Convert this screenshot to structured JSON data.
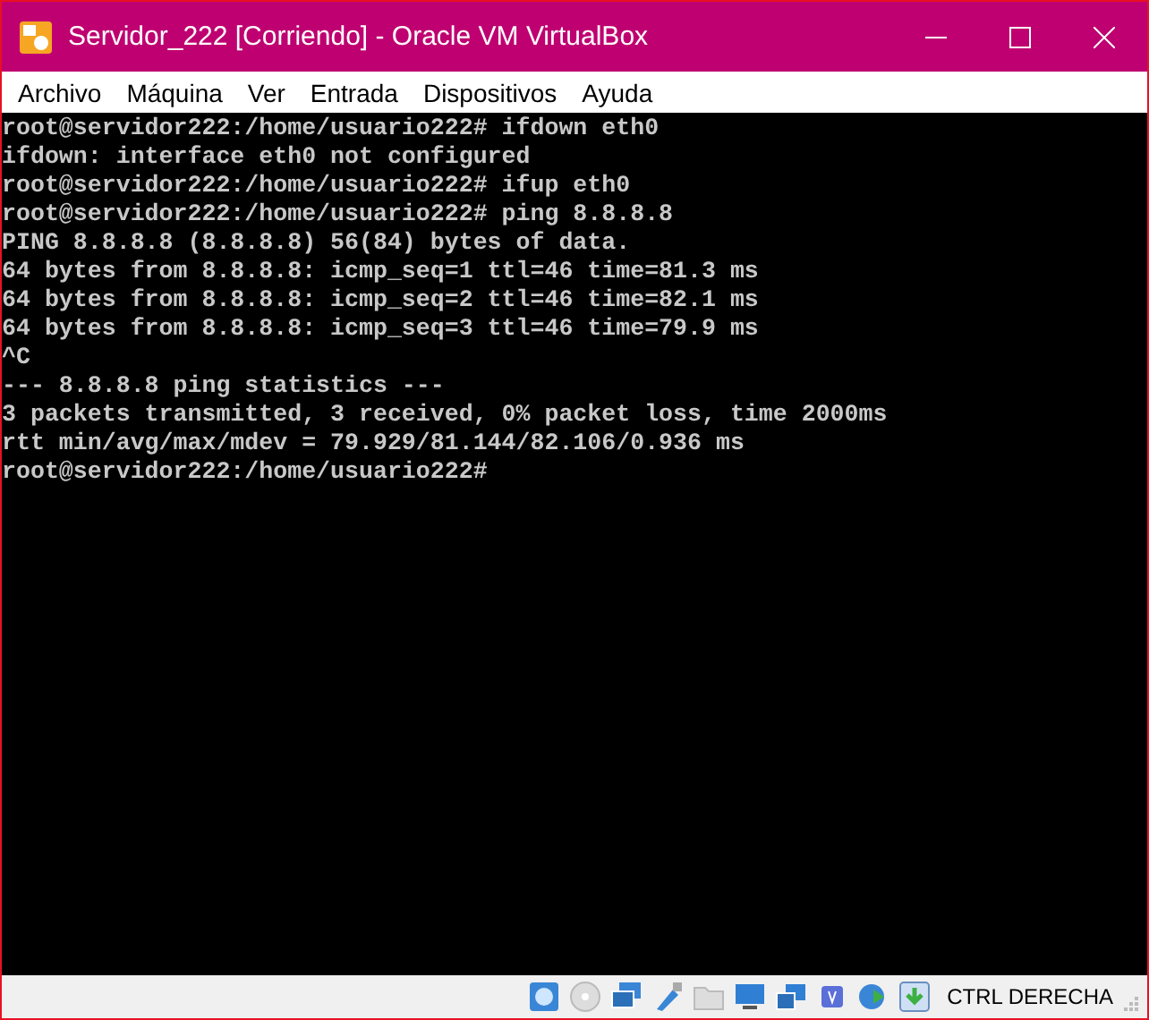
{
  "window": {
    "title": "Servidor_222 [Corriendo] - Oracle VM VirtualBox"
  },
  "menu": [
    "Archivo",
    "Máquina",
    "Ver",
    "Entrada",
    "Dispositivos",
    "Ayuda"
  ],
  "terminal": {
    "lines": [
      "root@servidor222:/home/usuario222# ifdown eth0",
      "ifdown: interface eth0 not configured",
      "root@servidor222:/home/usuario222# ifup eth0",
      "root@servidor222:/home/usuario222# ping 8.8.8.8",
      "PING 8.8.8.8 (8.8.8.8) 56(84) bytes of data.",
      "64 bytes from 8.8.8.8: icmp_seq=1 ttl=46 time=81.3 ms",
      "64 bytes from 8.8.8.8: icmp_seq=2 ttl=46 time=82.1 ms",
      "64 bytes from 8.8.8.8: icmp_seq=3 ttl=46 time=79.9 ms",
      "^C",
      "--- 8.8.8.8 ping statistics ---",
      "3 packets transmitted, 3 received, 0% packet loss, time 2000ms",
      "rtt min/avg/max/mdev = 79.929/81.144/82.106/0.936 ms",
      "root@servidor222:/home/usuario222#"
    ]
  },
  "status_bar": {
    "host_key": "CTRL DERECHA"
  }
}
